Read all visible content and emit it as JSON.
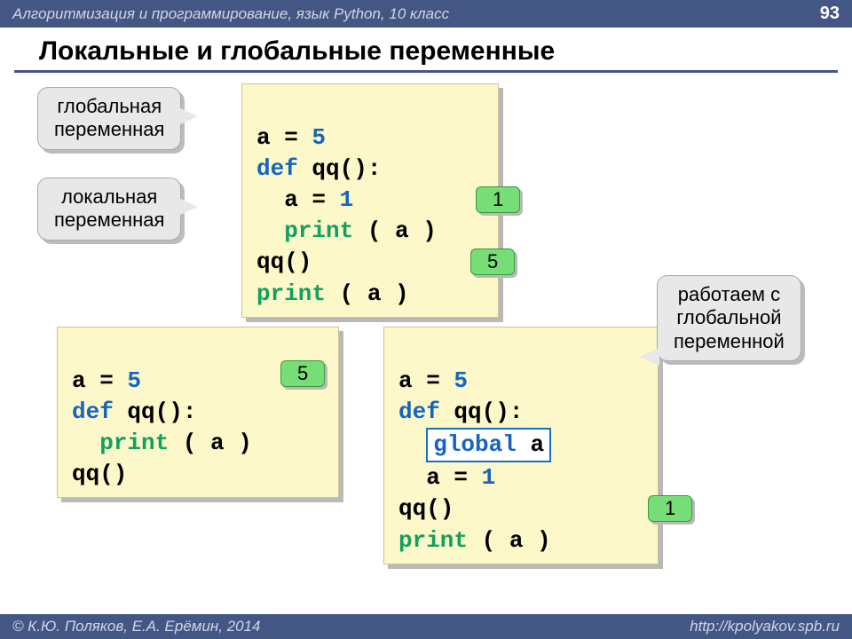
{
  "header": {
    "course": "Алгоритмизация и программирование, язык Python, 10 класс",
    "page": "93"
  },
  "title": "Локальные и глобальные переменные",
  "callouts": {
    "global_var": "глобальная\nпеременная",
    "local_var": "локальная\nпеременная",
    "work_global": "работаем с\nглобальной\nпеременной"
  },
  "code1": {
    "l1a": "a = ",
    "l1b": "5",
    "l2a": "def",
    "l2b": " qq():",
    "l3a": "  a = ",
    "l3b": "1",
    "l4a": "  ",
    "l4b": "print",
    "l4c": " ( a )",
    "l5": "qq()",
    "l6a": "print",
    "l6b": " ( a )"
  },
  "badges": {
    "b1": "1",
    "b5": "5"
  },
  "code2": {
    "l1a": "a = ",
    "l1b": "5",
    "l2a": "def",
    "l2b": " qq():",
    "l3a": "  ",
    "l3b": "print",
    "l3c": " ( a )",
    "l4": "qq()"
  },
  "code3": {
    "l1a": "a = ",
    "l1b": "5",
    "l2a": "def",
    "l2b": " qq():",
    "l3a": "global",
    "l3b": " a",
    "l4a": "  a = ",
    "l4b": "1",
    "l5": "qq()",
    "l6a": "print",
    "l6b": " ( a )"
  },
  "footer": {
    "left": "© К.Ю. Поляков, Е.А. Ерёмин, 2014",
    "right": "http://kpolyakov.spb.ru"
  }
}
